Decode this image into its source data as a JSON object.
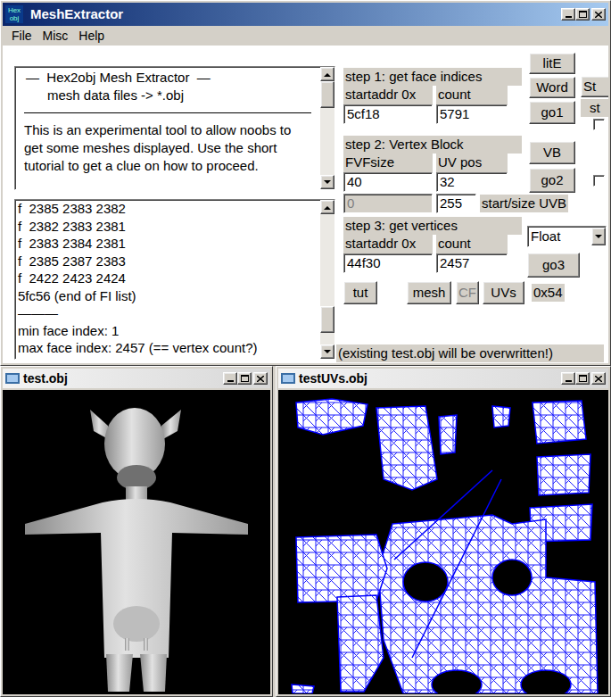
{
  "window": {
    "title": "MeshExtractor",
    "icon_text": [
      "Hex",
      "obj"
    ]
  },
  "menu": [
    {
      "label": "File"
    },
    {
      "label": "Misc"
    },
    {
      "label": "Help"
    }
  ],
  "intro": {
    "heading": "—  Hex2obj Mesh Extractor  —",
    "subheading": "mesh data files -> *.obj",
    "body": "This is an experimental tool to allow noobs to get some meshes displayed. Use the short tutorial to get a clue on how to proceed.",
    "scroll_level": 0
  },
  "log": {
    "lines": [
      "f  2385 2383 2382",
      "f  2382 2383 2381",
      "f  2383 2384 2381",
      "f  2385 2387 2383",
      "f  2422 2423 2424",
      "5fc56 (end of FI list)",
      "———",
      "min face index: 1",
      "max face index: 2457 (== vertex count?)"
    ],
    "scroll_level": 0.9
  },
  "step1": {
    "label": "step 1: get face indices",
    "fields": [
      {
        "label": "startaddr 0x",
        "value": "5cf18"
      },
      {
        "label": "count",
        "value": "5791"
      }
    ],
    "buttons": [
      {
        "label": "litE"
      },
      {
        "label": "Word"
      },
      {
        "label": "go1"
      }
    ]
  },
  "step2": {
    "label": "step 2: Vertex Block",
    "fields": [
      {
        "label": "FVFsize",
        "value": "40"
      },
      {
        "label": "UV pos",
        "value": "32"
      }
    ],
    "uvb_fields": [
      {
        "value": "0",
        "disabled": true
      },
      {
        "value": "255",
        "disabled": false
      }
    ],
    "uvb_label": "start/size UVB",
    "buttons": [
      {
        "label": "VB"
      },
      {
        "label": "go2"
      }
    ],
    "checkbox": {
      "checked": false
    }
  },
  "step3": {
    "label": "step 3: get vertices",
    "fields": [
      {
        "label": "startaddr 0x",
        "value": "44f30"
      },
      {
        "label": "count",
        "value": "2457"
      }
    ],
    "format": "Float",
    "buttons": [
      {
        "label": "go3"
      }
    ]
  },
  "side": {
    "cut_button": "St",
    "cut_label": "st",
    "checkbox": {
      "checked": false
    }
  },
  "toolbar": {
    "buttons": [
      {
        "label": "tut",
        "disabled": false
      },
      {
        "label": "mesh",
        "disabled": false
      },
      {
        "label": "CF",
        "disabled": true
      },
      {
        "label": "UVs",
        "disabled": false
      }
    ],
    "readout": "0x54"
  },
  "warning": "(existing test.obj will be overwritten!)",
  "viewers": [
    {
      "title": "test.obj",
      "kind": "render"
    },
    {
      "title": "testUVs.obj",
      "kind": "uv"
    }
  ]
}
